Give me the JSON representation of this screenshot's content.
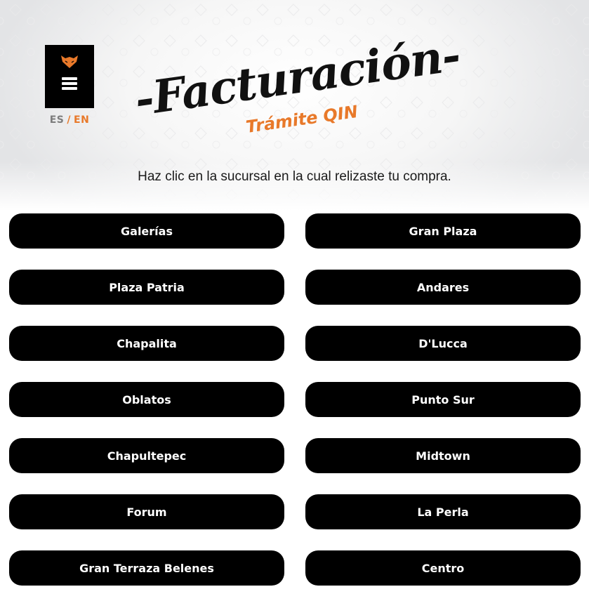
{
  "header": {
    "title": "-Facturación-",
    "subtitle": "Trámite QIN",
    "brand_colors": {
      "accent": "#e8792a",
      "dark": "#000000"
    }
  },
  "menu": {
    "logo_icon": "fox-logo-icon",
    "menu_icon": "hamburger-menu-icon"
  },
  "language": {
    "es": "ES",
    "separator": "/",
    "en": "EN"
  },
  "instruction": "Haz clic en la sucursal en la cual relizaste tu compra.",
  "branches": [
    "Galerías",
    "Gran Plaza",
    "Plaza Patria",
    "Andares",
    "Chapalita",
    "D'Lucca",
    "Oblatos",
    "Punto Sur",
    "Chapultepec",
    "Midtown",
    "Forum",
    "La Perla",
    "Gran Terraza Belenes",
    "Centro"
  ]
}
